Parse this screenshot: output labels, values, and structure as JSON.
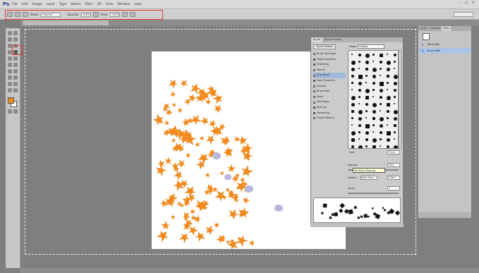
{
  "app": {
    "logo": "Ps",
    "menu": [
      "File",
      "Edit",
      "Image",
      "Layer",
      "Type",
      "Select",
      "Filter",
      "3D",
      "View",
      "Window",
      "Help"
    ],
    "window_controls": "– □ ×"
  },
  "options_bar": {
    "mode_label": "Mode:",
    "mode_value": "Normal",
    "opacity_label": "Opacity:",
    "opacity_value": "100%",
    "flow_label": "Flow:",
    "flow_value": "100%"
  },
  "document_tab": {
    "label": ""
  },
  "colors": {
    "foreground": "#f28b1e",
    "background": "#ffffff",
    "highlight": "#e23a2c",
    "leaf": "#f08a1e",
    "dab": "#b7b7e0"
  },
  "brush_panel": {
    "tabs": [
      "Brush",
      "Brush Presets"
    ],
    "presets_button": "Brush Presets",
    "options": [
      {
        "label": "Brush Tip Shape",
        "checked": false,
        "selected": false
      },
      {
        "label": "Shape Dynamics",
        "checked": true,
        "selected": false
      },
      {
        "label": "Scattering",
        "checked": true,
        "selected": false
      },
      {
        "label": "Texture",
        "checked": false,
        "selected": false
      },
      {
        "label": "Dual Brush",
        "checked": false,
        "selected": true
      },
      {
        "label": "Color Dynamics",
        "checked": true,
        "selected": false
      },
      {
        "label": "Transfer",
        "checked": false,
        "selected": false
      },
      {
        "label": "Brush Pose",
        "checked": false,
        "selected": false
      },
      {
        "label": "Noise",
        "checked": false,
        "selected": false
      },
      {
        "label": "Wet Edges",
        "checked": false,
        "selected": false
      },
      {
        "label": "Build-up",
        "checked": true,
        "selected": false
      },
      {
        "label": "Smoothing",
        "checked": true,
        "selected": false
      },
      {
        "label": "Protect Texture",
        "checked": false,
        "selected": false
      }
    ],
    "mode_label": "Mode:",
    "mode_value": "Multiply",
    "size_label": "Size:",
    "size_value": "76 px",
    "spacing_label": "Spacing",
    "spacing_value": "25%",
    "scatter_label": "Scatter",
    "scatter_value": "Both Axes",
    "scatter_amount": "226%",
    "count_label": "Count",
    "count_value": "1"
  },
  "tooltip": "Set Brush Spacing",
  "layers_panel": {
    "tabs": [
      "Layers",
      "Channels",
      "Paths"
    ],
    "rows": [
      {
        "label": "Work Path",
        "selected": false
      },
      {
        "label": "Brush Path",
        "selected": true
      }
    ]
  },
  "status": ""
}
